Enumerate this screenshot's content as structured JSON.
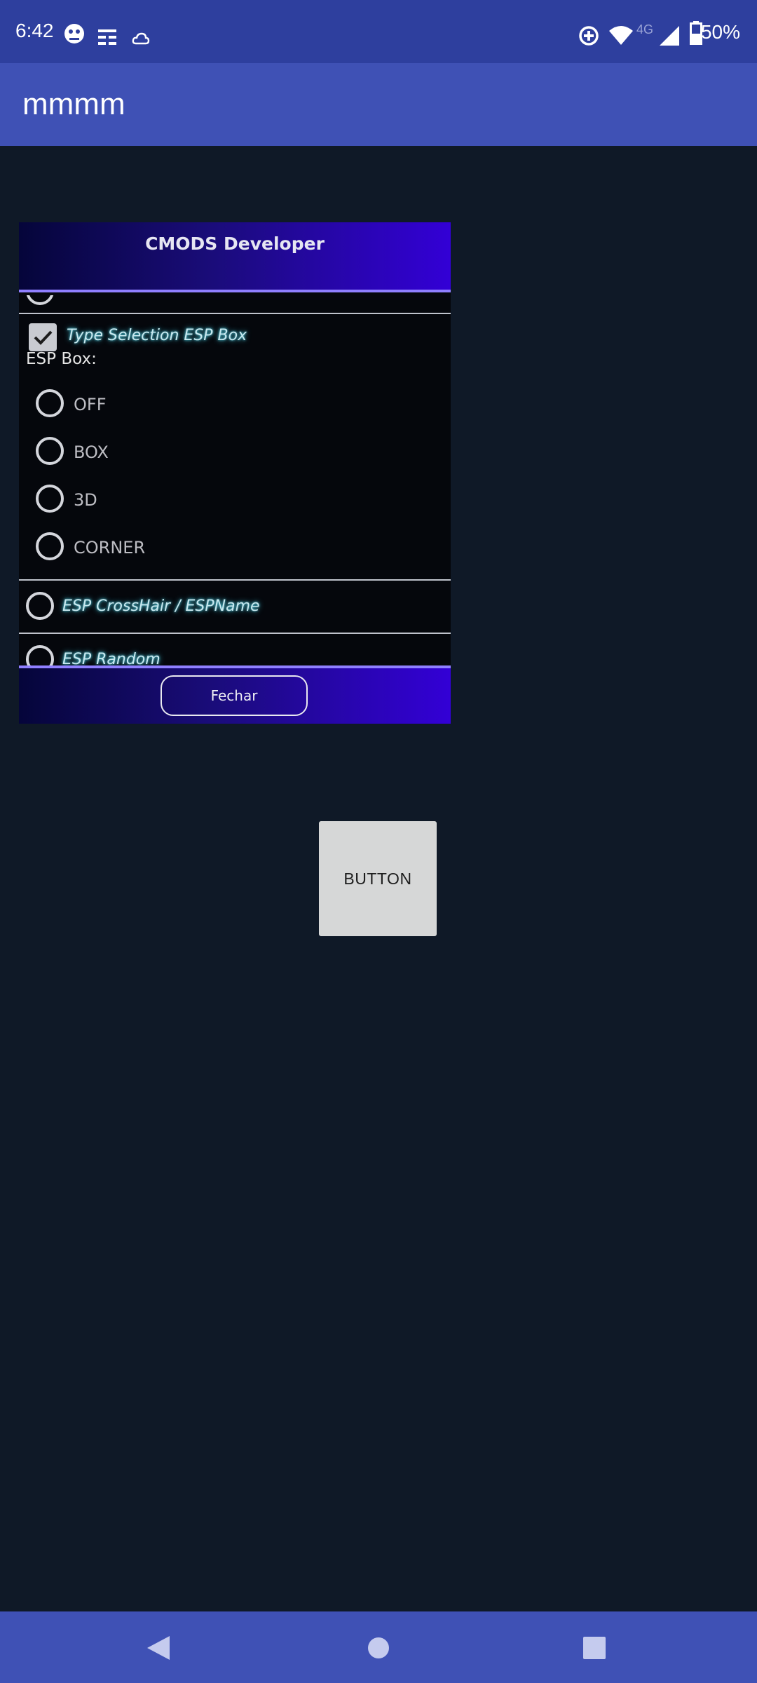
{
  "status_bar": {
    "time": "6:42",
    "network_label": "4G",
    "battery": "50%"
  },
  "app_bar": {
    "title": "mmmm"
  },
  "menu": {
    "title": "CMODS Developer",
    "type_selection_label": "Type Selection ESP Box",
    "type_selection_checked": true,
    "esp_box_heading": "ESP Box:",
    "esp_box_options": [
      "OFF",
      "BOX",
      "3D",
      "CORNER"
    ],
    "crosshair_label": "ESP CrossHair / ESPName",
    "random_label": "ESP Random",
    "close_label": "Fechar"
  },
  "button": {
    "label": "BUTTON"
  },
  "colors": {
    "status_bar": "#2e3f9e",
    "app_bar": "#3f51b5",
    "background": "#0f1927",
    "menu_accent": "#3300d6"
  }
}
